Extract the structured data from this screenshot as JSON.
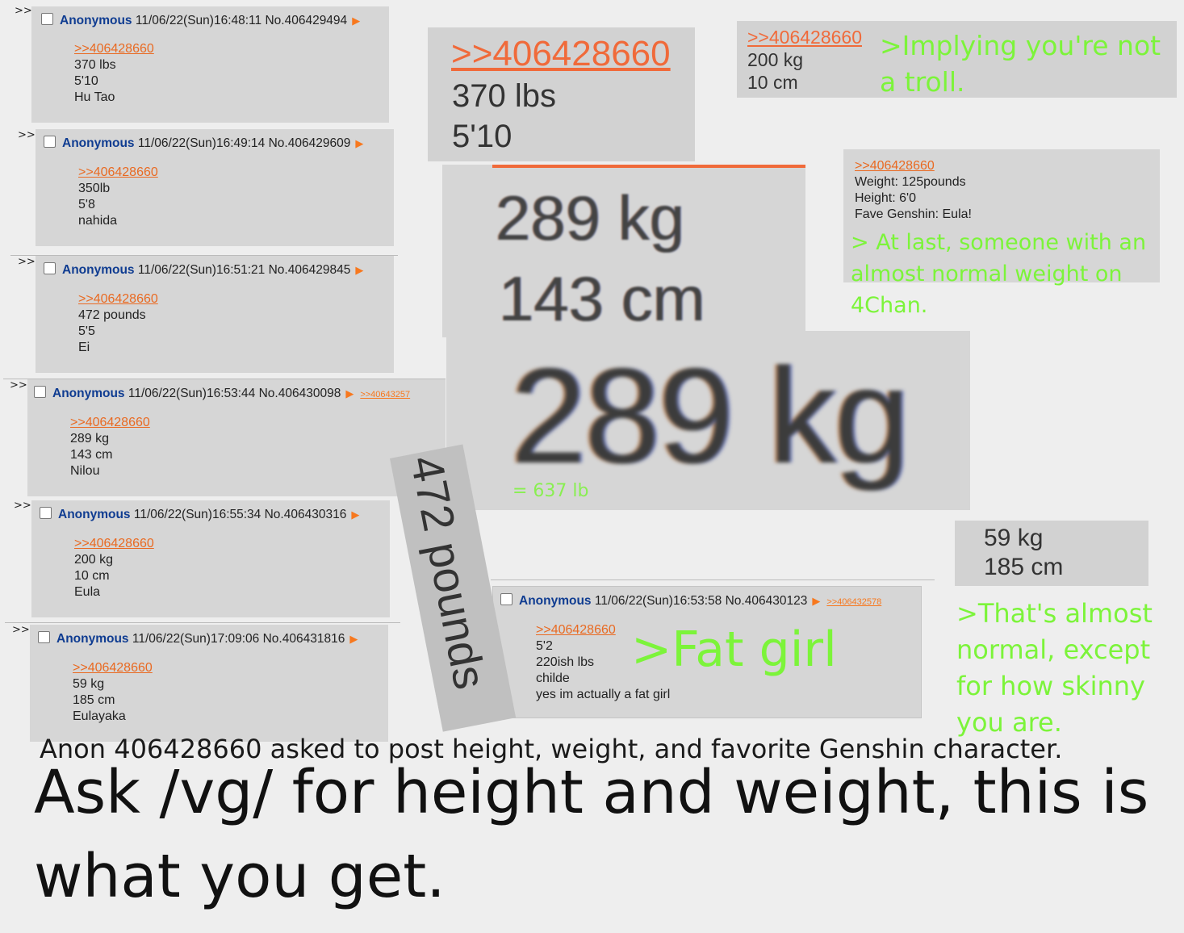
{
  "posts": [
    {
      "arrows": ">>",
      "name": "Anonymous",
      "date": "11/06/22(Sun)16:48:11",
      "no": "No.406429494",
      "quote": ">>406428660",
      "lines": [
        "370 lbs",
        "5'10",
        "Hu Tao"
      ]
    },
    {
      "arrows": ">>",
      "name": "Anonymous",
      "date": "11/06/22(Sun)16:49:14",
      "no": "No.406429609",
      "quote": ">>406428660",
      "lines": [
        "350lb",
        "5'8",
        "nahida"
      ]
    },
    {
      "arrows": ">>",
      "name": "Anonymous",
      "date": "11/06/22(Sun)16:51:21",
      "no": "No.406429845",
      "quote": ">>406428660",
      "lines": [
        "472 pounds",
        "5'5",
        "Ei"
      ]
    },
    {
      "arrows": ">>",
      "name": "Anonymous",
      "date": "11/06/22(Sun)16:53:44",
      "no": "No.406430098",
      "backlink": ">>40643257",
      "quote": ">>406428660",
      "lines": [
        "289 kg",
        "143 cm",
        "Nilou"
      ]
    },
    {
      "arrows": ">>",
      "name": "Anonymous",
      "date": "11/06/22(Sun)16:55:34",
      "no": "No.406430316",
      "quote": ">>406428660",
      "lines": [
        "200 kg",
        "10 cm",
        "Eula"
      ]
    },
    {
      "arrows": ">>",
      "name": "Anonymous",
      "date": "11/06/22(Sun)17:09:06",
      "no": "No.406431816",
      "quote": ">>406428660",
      "lines": [
        "59 kg",
        "185 cm",
        "Eulayaka"
      ]
    },
    {
      "arrows": ">>",
      "name": "Anonymous",
      "date": "11/06/22(Sun)16:53:58",
      "no": "No.406430123",
      "backlink": ">>406432578",
      "quote": ">>406428660",
      "lines": [
        "5'2",
        "220ish lbs",
        "childe",
        "yes im actually a fat girl"
      ]
    }
  ],
  "zoom_hutao": {
    "quote": ">>406428660",
    "line1": "370 lbs",
    "line2": "5'10"
  },
  "zoom_nilou": {
    "line1": "289 kg",
    "line2": "143 cm"
  },
  "zoom_289": {
    "text": "289 kg",
    "note": "= 637 lb"
  },
  "zoom_eula": {
    "quote": ">>406428660",
    "line1": "200 kg",
    "line2": "10 cm",
    "comment": ">Implying you're not a troll."
  },
  "zoom_126": {
    "quote": ">>406428660",
    "line1": "Weight: 125pounds",
    "line2": "Height: 6'0",
    "line3": "Fave Genshin: Eula!",
    "comment": "> At last, someone with an almost normal weight on 4Chan."
  },
  "zoom_eulayaka": {
    "line1": "59 kg",
    "line2": "185 cm",
    "comment": ">That's almost normal, except for how skinny you are."
  },
  "rotated_label": "472 pounds",
  "fat_girl_comment": ">Fat girl",
  "caption_small": "Anon 406428660 asked to post height, weight, and favorite Genshin character.",
  "caption_big": "Ask /vg/ for height and weight, this is what you get."
}
